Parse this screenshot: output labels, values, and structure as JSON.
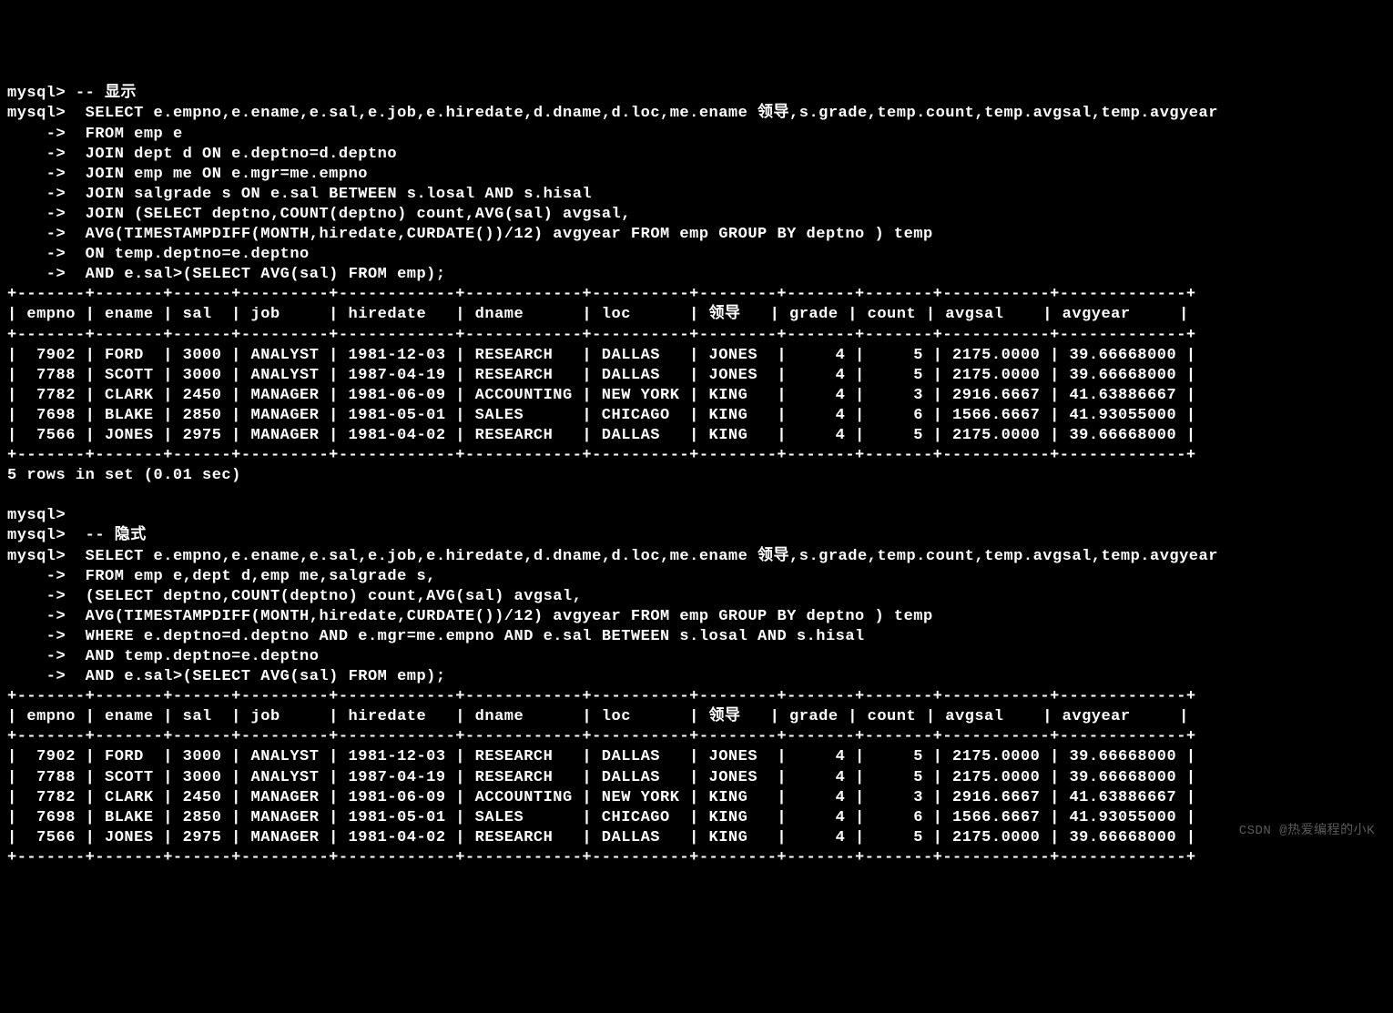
{
  "block1": {
    "prompt1": "mysql> ",
    "comment": "-- 显示",
    "prompt2": "mysql>  ",
    "select": "SELECT e.empno,e.ename,e.sal,e.job,e.hiredate,d.dname,d.loc,me.ename 领导,s.grade,temp.count,temp.avgsal,temp.avgyear",
    "cont": "    ->  ",
    "l2": "FROM emp e",
    "l3": "JOIN dept d ON e.deptno=d.deptno",
    "l4": "JOIN emp me ON e.mgr=me.empno",
    "l5": "JOIN salgrade s ON e.sal BETWEEN s.losal AND s.hisal",
    "l6": "JOIN (SELECT deptno,COUNT(deptno) count,AVG(sal) avgsal,",
    "l7": "AVG(TIMESTAMPDIFF(MONTH,hiredate,CURDATE())/12) avgyear FROM emp GROUP BY deptno ) temp",
    "l8": "ON temp.deptno=e.deptno",
    "l9": "AND e.sal>(SELECT AVG(sal) FROM emp);"
  },
  "table": {
    "border": "+-------+-------+------+---------+------------+------------+----------+--------+-------+-------+-----------+-------------+",
    "header": "| empno | ename | sal  | job     | hiredate   | dname      | loc      | 领导   | grade | count | avgsal    | avgyear     |",
    "r1": "|  7902 | FORD  | 3000 | ANALYST | 1981-12-03 | RESEARCH   | DALLAS   | JONES  |     4 |     5 | 2175.0000 | 39.66668000 |",
    "r2": "|  7788 | SCOTT | 3000 | ANALYST | 1987-04-19 | RESEARCH   | DALLAS   | JONES  |     4 |     5 | 2175.0000 | 39.66668000 |",
    "r3": "|  7782 | CLARK | 2450 | MANAGER | 1981-06-09 | ACCOUNTING | NEW YORK | KING   |     4 |     3 | 2916.6667 | 41.63886667 |",
    "r4": "|  7698 | BLAKE | 2850 | MANAGER | 1981-05-01 | SALES      | CHICAGO  | KING   |     4 |     6 | 1566.6667 | 41.93055000 |",
    "r5": "|  7566 | JONES | 2975 | MANAGER | 1981-04-02 | RESEARCH   | DALLAS   | KING   |     4 |     5 | 2175.0000 | 39.66668000 |"
  },
  "footer1": "5 rows in set (0.01 sec)",
  "empty_prompt": "mysql>",
  "block2": {
    "prompt1": "mysql>  ",
    "comment": "-- 隐式",
    "prompt2": "mysql>  ",
    "select": "SELECT e.empno,e.ename,e.sal,e.job,e.hiredate,d.dname,d.loc,me.ename 领导,s.grade,temp.count,temp.avgsal,temp.avgyear",
    "cont": "    ->  ",
    "l2": "FROM emp e,dept d,emp me,salgrade s,",
    "l3": "(SELECT deptno,COUNT(deptno) count,AVG(sal) avgsal,",
    "l4": "AVG(TIMESTAMPDIFF(MONTH,hiredate,CURDATE())/12) avgyear FROM emp GROUP BY deptno ) temp",
    "l5": "WHERE e.deptno=d.deptno AND e.mgr=me.empno AND e.sal BETWEEN s.losal AND s.hisal",
    "l6": "AND temp.deptno=e.deptno",
    "l7": "AND e.sal>(SELECT AVG(sal) FROM emp);"
  },
  "watermark": "CSDN @热爱编程的小K"
}
